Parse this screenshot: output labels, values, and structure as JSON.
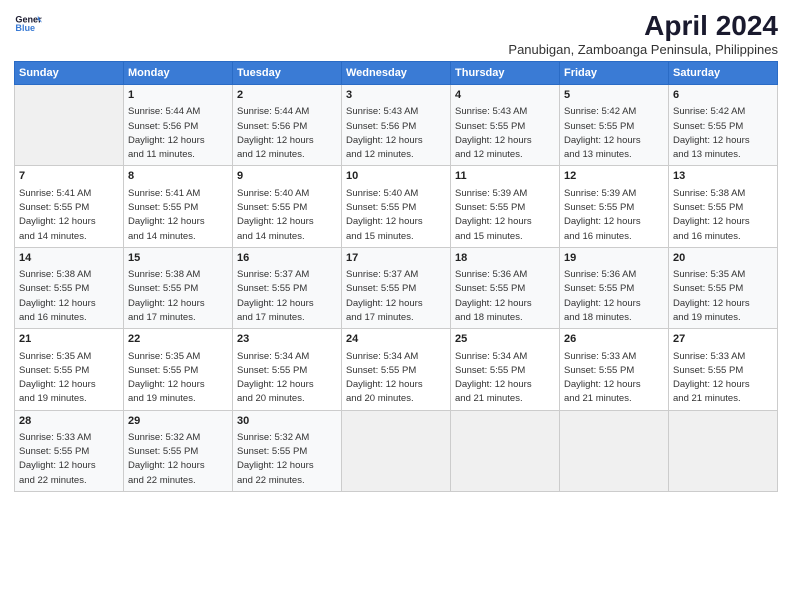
{
  "logo": {
    "line1": "General",
    "line2": "Blue"
  },
  "title": "April 2024",
  "subtitle": "Panubigan, Zamboanga Peninsula, Philippines",
  "days_header": [
    "Sunday",
    "Monday",
    "Tuesday",
    "Wednesday",
    "Thursday",
    "Friday",
    "Saturday"
  ],
  "weeks": [
    [
      {
        "num": "",
        "info": ""
      },
      {
        "num": "1",
        "info": "Sunrise: 5:44 AM\nSunset: 5:56 PM\nDaylight: 12 hours\nand 11 minutes."
      },
      {
        "num": "2",
        "info": "Sunrise: 5:44 AM\nSunset: 5:56 PM\nDaylight: 12 hours\nand 12 minutes."
      },
      {
        "num": "3",
        "info": "Sunrise: 5:43 AM\nSunset: 5:56 PM\nDaylight: 12 hours\nand 12 minutes."
      },
      {
        "num": "4",
        "info": "Sunrise: 5:43 AM\nSunset: 5:55 PM\nDaylight: 12 hours\nand 12 minutes."
      },
      {
        "num": "5",
        "info": "Sunrise: 5:42 AM\nSunset: 5:55 PM\nDaylight: 12 hours\nand 13 minutes."
      },
      {
        "num": "6",
        "info": "Sunrise: 5:42 AM\nSunset: 5:55 PM\nDaylight: 12 hours\nand 13 minutes."
      }
    ],
    [
      {
        "num": "7",
        "info": "Sunrise: 5:41 AM\nSunset: 5:55 PM\nDaylight: 12 hours\nand 14 minutes."
      },
      {
        "num": "8",
        "info": "Sunrise: 5:41 AM\nSunset: 5:55 PM\nDaylight: 12 hours\nand 14 minutes."
      },
      {
        "num": "9",
        "info": "Sunrise: 5:40 AM\nSunset: 5:55 PM\nDaylight: 12 hours\nand 14 minutes."
      },
      {
        "num": "10",
        "info": "Sunrise: 5:40 AM\nSunset: 5:55 PM\nDaylight: 12 hours\nand 15 minutes."
      },
      {
        "num": "11",
        "info": "Sunrise: 5:39 AM\nSunset: 5:55 PM\nDaylight: 12 hours\nand 15 minutes."
      },
      {
        "num": "12",
        "info": "Sunrise: 5:39 AM\nSunset: 5:55 PM\nDaylight: 12 hours\nand 16 minutes."
      },
      {
        "num": "13",
        "info": "Sunrise: 5:38 AM\nSunset: 5:55 PM\nDaylight: 12 hours\nand 16 minutes."
      }
    ],
    [
      {
        "num": "14",
        "info": "Sunrise: 5:38 AM\nSunset: 5:55 PM\nDaylight: 12 hours\nand 16 minutes."
      },
      {
        "num": "15",
        "info": "Sunrise: 5:38 AM\nSunset: 5:55 PM\nDaylight: 12 hours\nand 17 minutes."
      },
      {
        "num": "16",
        "info": "Sunrise: 5:37 AM\nSunset: 5:55 PM\nDaylight: 12 hours\nand 17 minutes."
      },
      {
        "num": "17",
        "info": "Sunrise: 5:37 AM\nSunset: 5:55 PM\nDaylight: 12 hours\nand 17 minutes."
      },
      {
        "num": "18",
        "info": "Sunrise: 5:36 AM\nSunset: 5:55 PM\nDaylight: 12 hours\nand 18 minutes."
      },
      {
        "num": "19",
        "info": "Sunrise: 5:36 AM\nSunset: 5:55 PM\nDaylight: 12 hours\nand 18 minutes."
      },
      {
        "num": "20",
        "info": "Sunrise: 5:35 AM\nSunset: 5:55 PM\nDaylight: 12 hours\nand 19 minutes."
      }
    ],
    [
      {
        "num": "21",
        "info": "Sunrise: 5:35 AM\nSunset: 5:55 PM\nDaylight: 12 hours\nand 19 minutes."
      },
      {
        "num": "22",
        "info": "Sunrise: 5:35 AM\nSunset: 5:55 PM\nDaylight: 12 hours\nand 19 minutes."
      },
      {
        "num": "23",
        "info": "Sunrise: 5:34 AM\nSunset: 5:55 PM\nDaylight: 12 hours\nand 20 minutes."
      },
      {
        "num": "24",
        "info": "Sunrise: 5:34 AM\nSunset: 5:55 PM\nDaylight: 12 hours\nand 20 minutes."
      },
      {
        "num": "25",
        "info": "Sunrise: 5:34 AM\nSunset: 5:55 PM\nDaylight: 12 hours\nand 21 minutes."
      },
      {
        "num": "26",
        "info": "Sunrise: 5:33 AM\nSunset: 5:55 PM\nDaylight: 12 hours\nand 21 minutes."
      },
      {
        "num": "27",
        "info": "Sunrise: 5:33 AM\nSunset: 5:55 PM\nDaylight: 12 hours\nand 21 minutes."
      }
    ],
    [
      {
        "num": "28",
        "info": "Sunrise: 5:33 AM\nSunset: 5:55 PM\nDaylight: 12 hours\nand 22 minutes."
      },
      {
        "num": "29",
        "info": "Sunrise: 5:32 AM\nSunset: 5:55 PM\nDaylight: 12 hours\nand 22 minutes."
      },
      {
        "num": "30",
        "info": "Sunrise: 5:32 AM\nSunset: 5:55 PM\nDaylight: 12 hours\nand 22 minutes."
      },
      {
        "num": "",
        "info": ""
      },
      {
        "num": "",
        "info": ""
      },
      {
        "num": "",
        "info": ""
      },
      {
        "num": "",
        "info": ""
      }
    ]
  ]
}
